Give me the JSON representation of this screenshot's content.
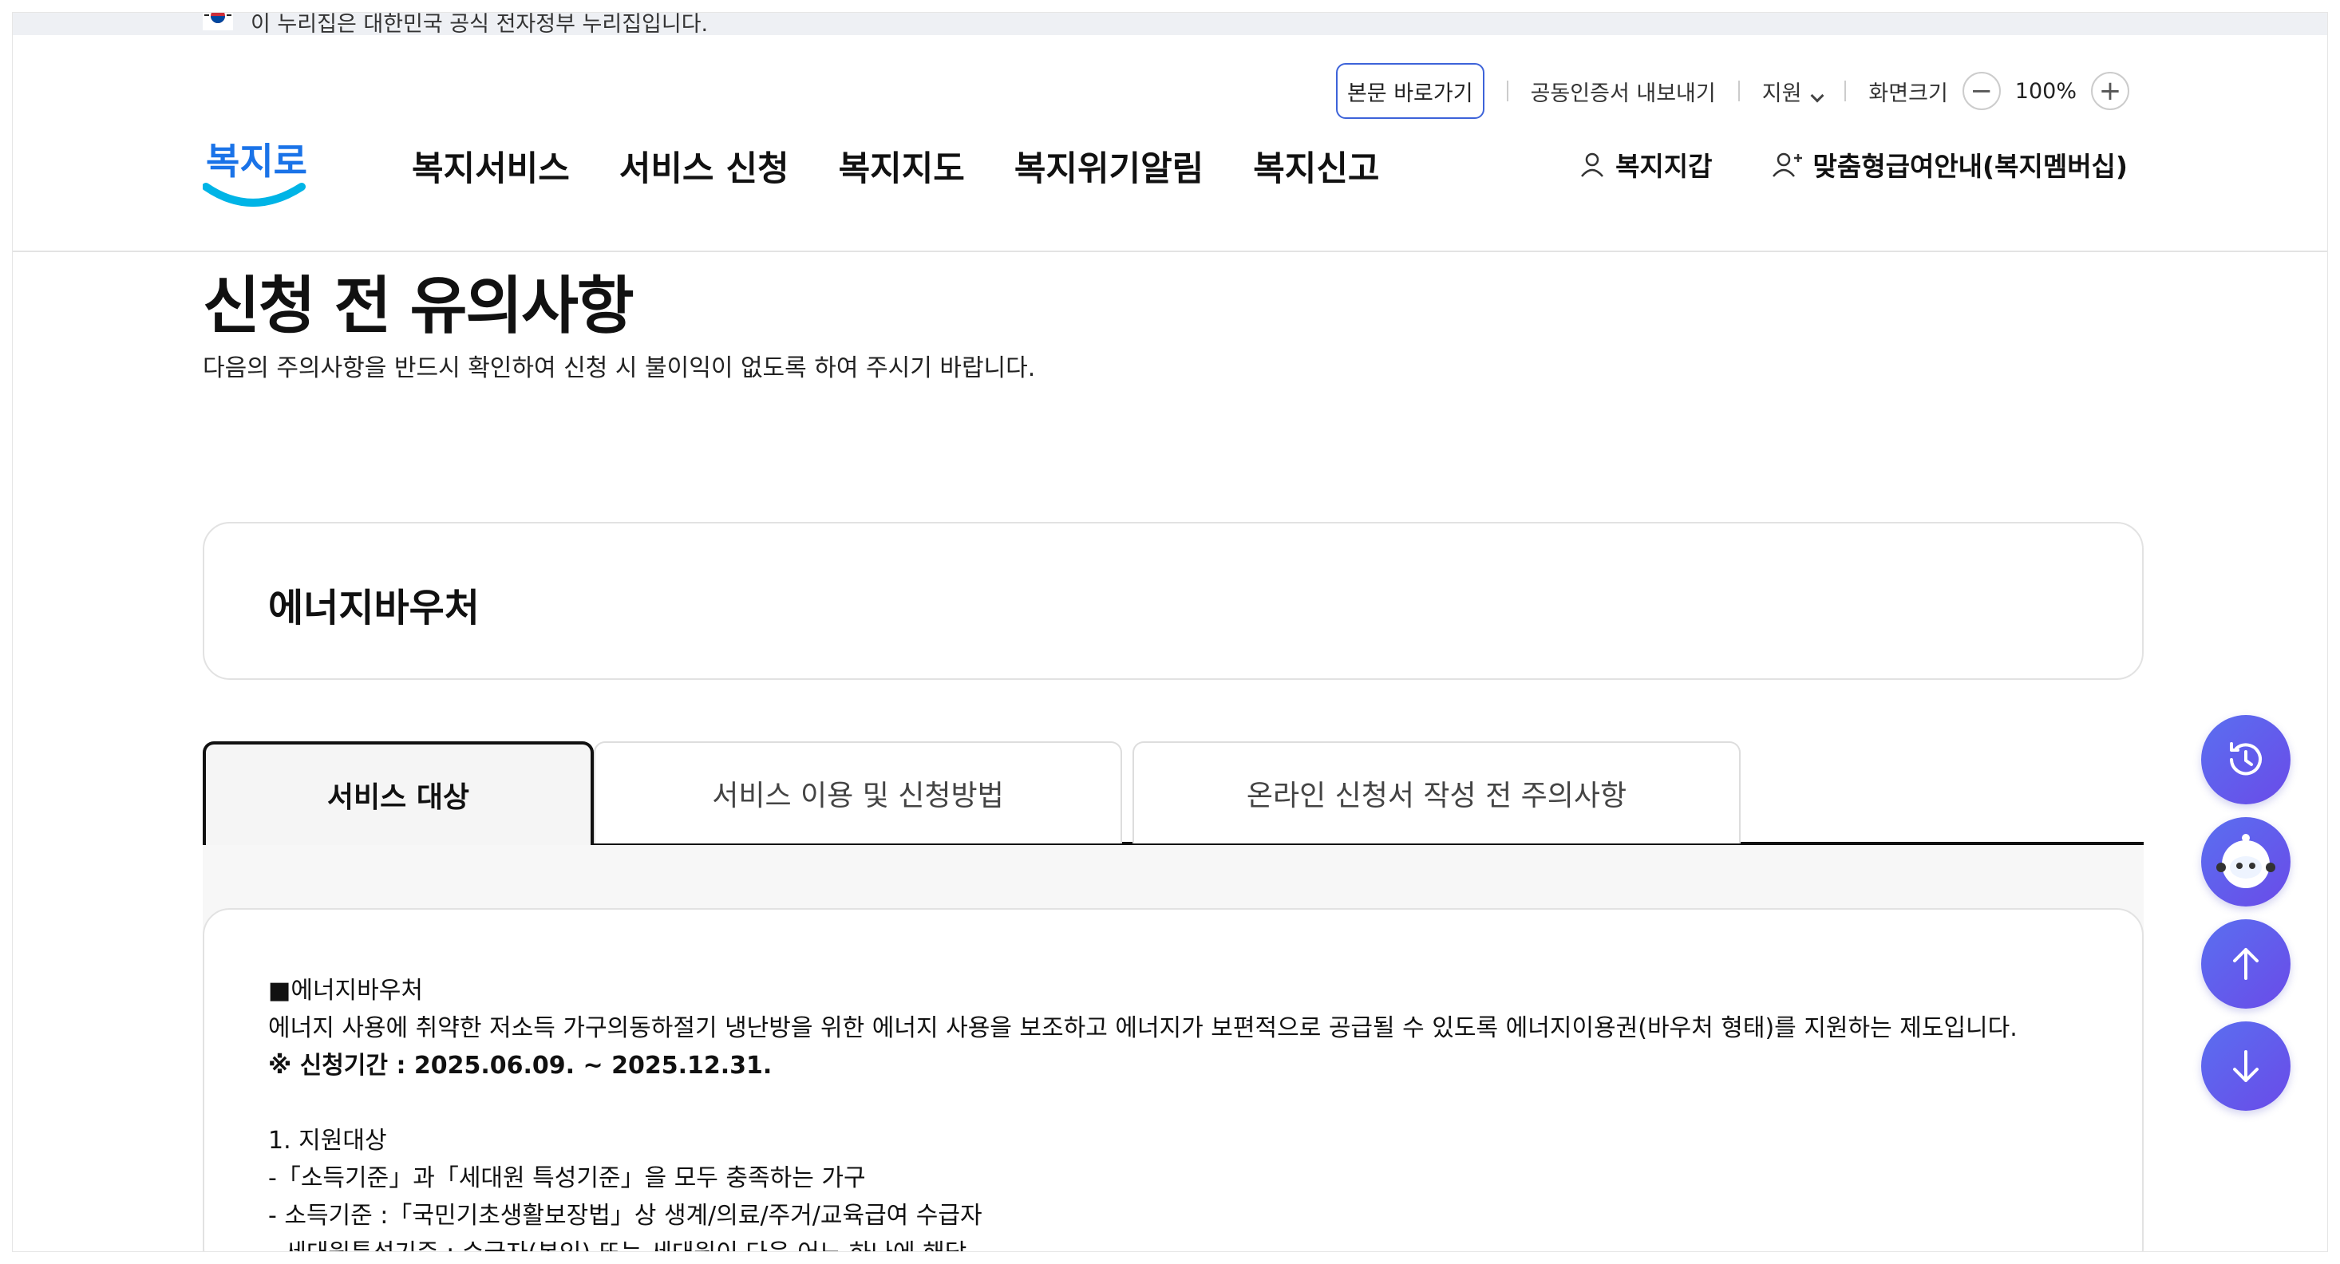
{
  "gov_banner": {
    "text": "이 누리집은 대한민국 공식 전자정부 누리집입니다."
  },
  "util": {
    "skip": "본문 바로가기",
    "cert": "공동인증서 내보내기",
    "support": "지원",
    "zoom_label": "화면크기",
    "zoom_minus": "−",
    "zoom_value": "100%",
    "zoom_plus": "+"
  },
  "logo": {
    "text": "복지로",
    "colors": {
      "blue": "#1a73e8",
      "cyan": "#00b4e6"
    }
  },
  "gnb": [
    {
      "label": "복지서비스"
    },
    {
      "label": "서비스 신청"
    },
    {
      "label": "복지지도"
    },
    {
      "label": "복지위기알림"
    },
    {
      "label": "복지신고"
    }
  ],
  "user_menu": {
    "wallet": "복지지갑",
    "membership": "맞춤형급여안내(복지멤버십)"
  },
  "page": {
    "title": "신청 전 유의사항",
    "desc": "다음의 주의사항을 반드시 확인하여 신청 시 불이익이 없도록 하여 주시기 바랍니다."
  },
  "service": {
    "name": "에너지바우처"
  },
  "tabs": [
    {
      "label": "서비스 대상"
    },
    {
      "label": "서비스 이용 및 신청방법"
    },
    {
      "label": "온라인 신청서 작성 전 주의사항"
    }
  ],
  "content": {
    "line1": "■에너지바우처",
    "line2": "에너지 사용에 취약한 저소득 가구의동하절기 냉난방을 위한 에너지 사용을 보조하고 에너지가 보편적으로 공급될 수 있도록 에너지이용권(바우처 형태)를 지원하는 제도입니다.",
    "line3": "※ 신청기간 : 2025.06.09. ~ 2025.12.31.",
    "line4": "1. 지원대상",
    "line5": "-「소득기준」과「세대원 특성기준」을 모두 충족하는 가구",
    "line6": "- 소득기준 :「국민기초생활보장법」상 생계/의료/주거/교육급여 수급자",
    "line7": "- 세대원특성기준 : 수급자(본인) 또는 세대원이 다음 어느 하나에 해당"
  },
  "colors": {
    "accent": "#3d63d9",
    "fab": "#5a6ff0"
  },
  "fab_icons": [
    "history-icon",
    "chatbot-icon",
    "arrow-up-icon",
    "arrow-down-icon"
  ]
}
